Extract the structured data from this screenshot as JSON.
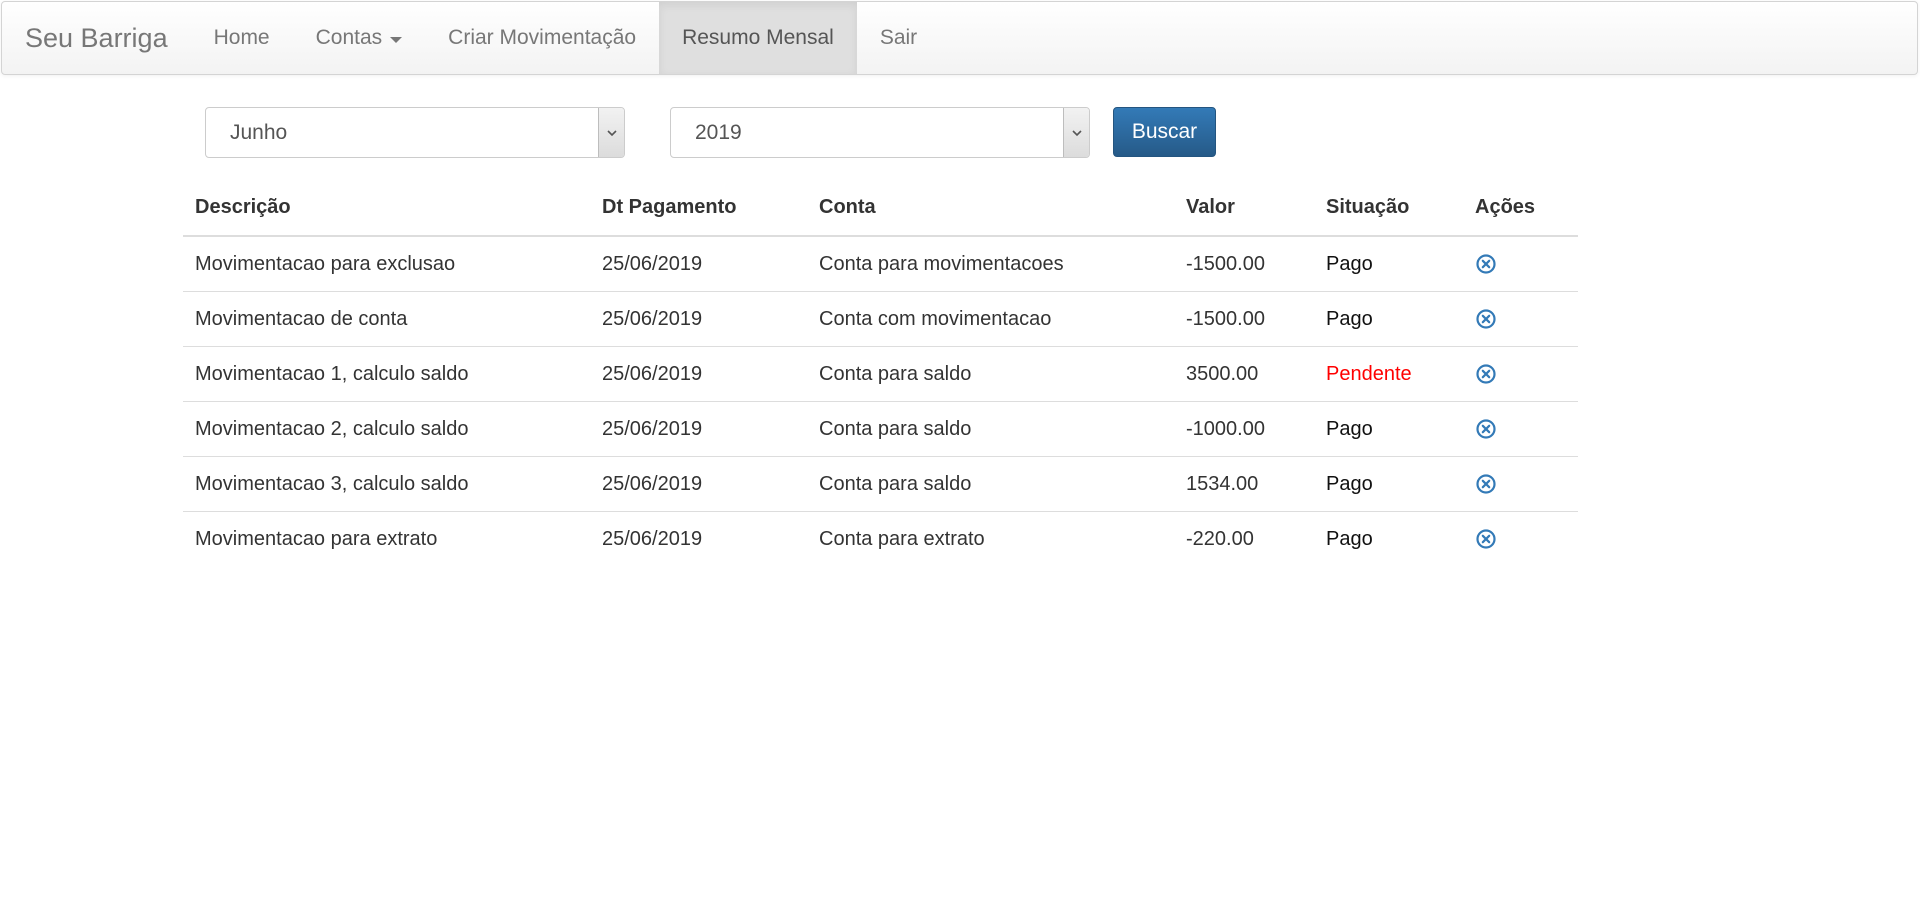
{
  "nav": {
    "brand": "Seu Barriga",
    "items": [
      {
        "label": "Home"
      },
      {
        "label": "Contas"
      },
      {
        "label": "Criar Movimentação"
      },
      {
        "label": "Resumo Mensal"
      },
      {
        "label": "Sair"
      }
    ]
  },
  "filters": {
    "month": "Junho",
    "year": "2019",
    "search_label": "Buscar"
  },
  "table": {
    "headers": [
      "Descrição",
      "Dt Pagamento",
      "Conta",
      "Valor",
      "Situação",
      "Ações"
    ],
    "rows": [
      {
        "descricao": "Movimentacao para exclusao",
        "dt_pagamento": "25/06/2019",
        "conta": "Conta para movimentacoes",
        "valor": "-1500.00",
        "situacao": "Pago"
      },
      {
        "descricao": "Movimentacao de conta",
        "dt_pagamento": "25/06/2019",
        "conta": "Conta com movimentacao",
        "valor": "-1500.00",
        "situacao": "Pago"
      },
      {
        "descricao": "Movimentacao 1, calculo saldo",
        "dt_pagamento": "25/06/2019",
        "conta": "Conta para saldo",
        "valor": "3500.00",
        "situacao": "Pendente"
      },
      {
        "descricao": "Movimentacao 2, calculo saldo",
        "dt_pagamento": "25/06/2019",
        "conta": "Conta para saldo",
        "valor": "-1000.00",
        "situacao": "Pago"
      },
      {
        "descricao": "Movimentacao 3, calculo saldo",
        "dt_pagamento": "25/06/2019",
        "conta": "Conta para saldo",
        "valor": "1534.00",
        "situacao": "Pago"
      },
      {
        "descricao": "Movimentacao para extrato",
        "dt_pagamento": "25/06/2019",
        "conta": "Conta para extrato",
        "valor": "-220.00",
        "situacao": "Pago"
      }
    ]
  },
  "colors": {
    "primary": "#337ab7",
    "pending": "#ff0000",
    "remove_icon": "#337ab7"
  },
  "icons": {
    "remove": "remove-circle-icon",
    "dropdown": "chevron-down-icon",
    "caret": "caret-down-icon"
  }
}
